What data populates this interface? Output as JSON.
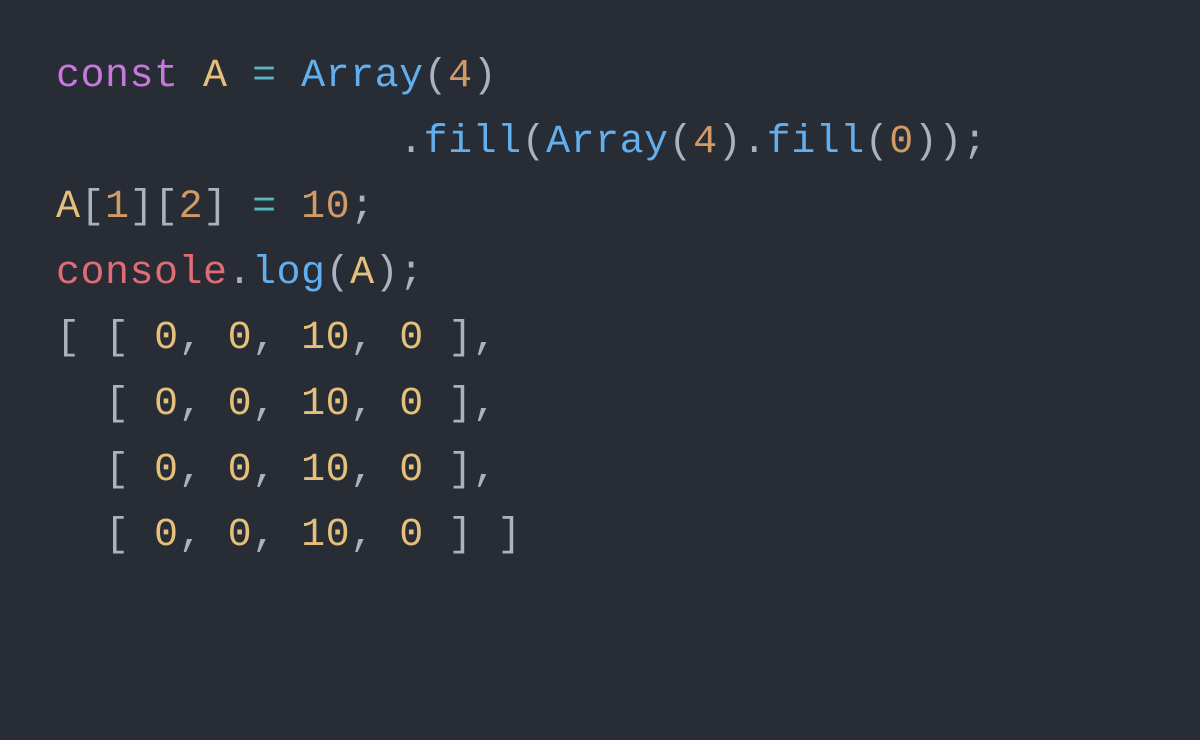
{
  "code": {
    "kw_const": "const",
    "var_A": "A",
    "op_eq": "=",
    "fn_Array": "Array",
    "lp": "(",
    "rp": ")",
    "num4_a": "4",
    "num4_b": "4",
    "num0": "0",
    "dot": ".",
    "fn_fill": "fill",
    "semi": ";",
    "lbrk": "[",
    "rbrk": "]",
    "idx1": "1",
    "idx2": "2",
    "num10": "10",
    "obj_console": "console",
    "fn_log": "log",
    "indent_fill": "              "
  },
  "output": {
    "lb": "[",
    "rb": "]",
    "comma": ",",
    "sp": " ",
    "rows": [
      [
        "0",
        "0",
        "10",
        "0"
      ],
      [
        "0",
        "0",
        "10",
        "0"
      ],
      [
        "0",
        "0",
        "10",
        "0"
      ],
      [
        "0",
        "0",
        "10",
        "0"
      ]
    ]
  }
}
